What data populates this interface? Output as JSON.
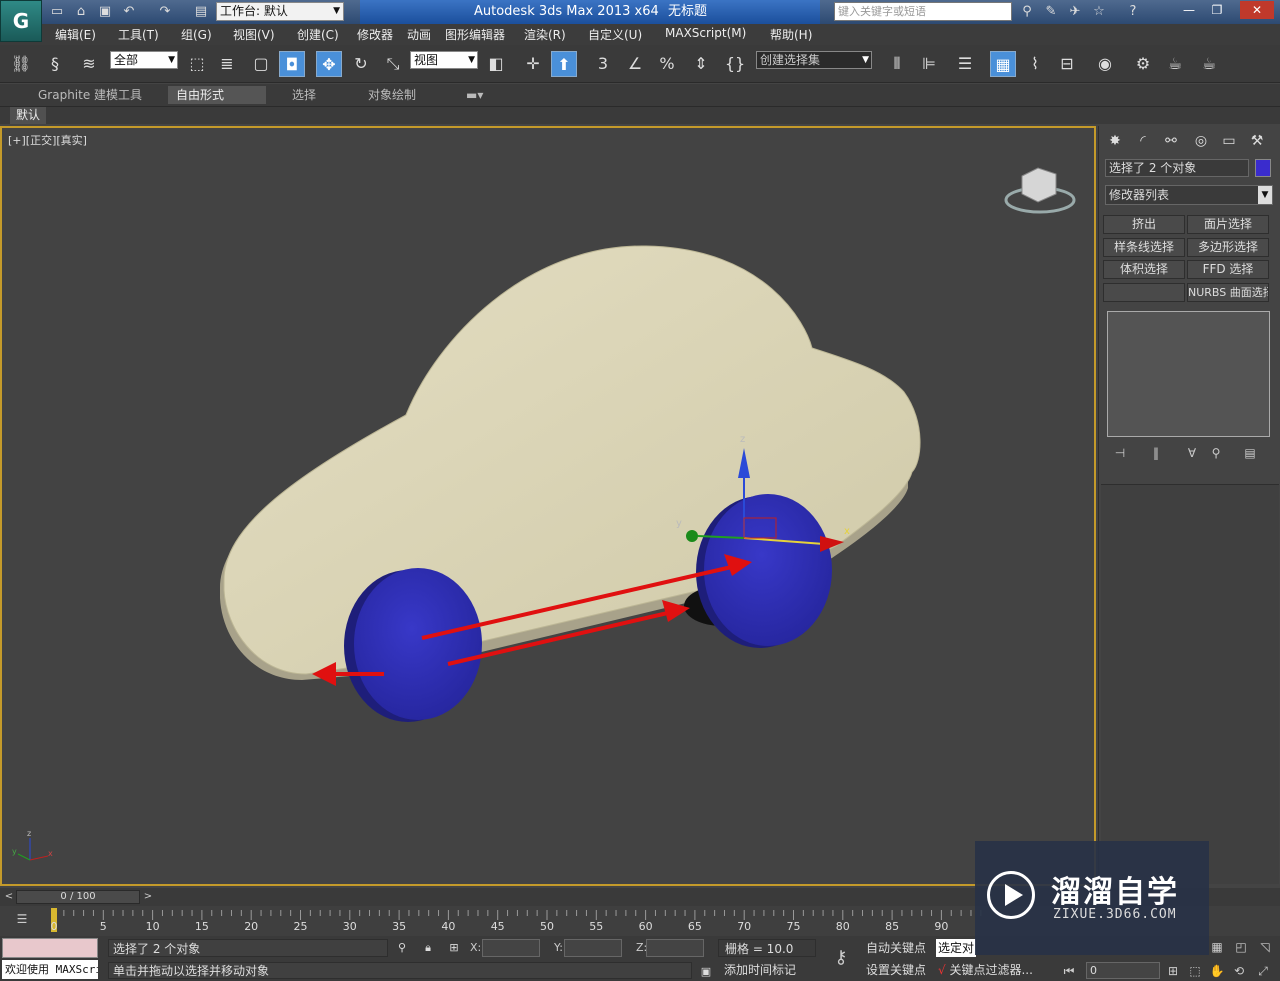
{
  "titlebar": {
    "workspace_label": "工作台: 默认",
    "app_title": "Autodesk 3ds Max  2013 x64",
    "document_title": "无标题",
    "search_placeholder": "键入关键字或短语"
  },
  "menu": [
    "编辑(E)",
    "工具(T)",
    "组(G)",
    "视图(V)",
    "创建(C)",
    "修改器",
    "动画",
    "图形编辑器",
    "渲染(R)",
    "自定义(U)",
    "MAXScript(M)",
    "帮助(H)"
  ],
  "toolbar": {
    "selection_filter": "全部",
    "ref_coord": "视图",
    "named_selection": "创建选择集",
    "snap_label": "3",
    "percent_label": "%"
  },
  "ribbon": {
    "tabs": [
      "Graphite 建模工具",
      "自由形式",
      "选择",
      "对象绘制"
    ],
    "active_tab": "自由形式",
    "sub_tab": "默认"
  },
  "viewport": {
    "label": "[+][正交][真实]",
    "gizmo_axes": {
      "x": "x",
      "y": "y",
      "z": "z"
    }
  },
  "command_panel": {
    "selection_text": "选择了 2 个对象",
    "selection_color": "#3a2ccd",
    "modifier_list": "修改器列表",
    "buttons": [
      {
        "label": "挤出"
      },
      {
        "label": "面片选择"
      },
      {
        "label": "样条线选择"
      },
      {
        "label": "多边形选择"
      },
      {
        "label": "体积选择"
      },
      {
        "label": "FFD 选择"
      },
      {
        "label": ""
      },
      {
        "label": "NURBS 曲面选择"
      }
    ]
  },
  "timeline": {
    "frame_text": "0 / 100",
    "ticks": [
      "0",
      "5",
      "10",
      "15",
      "20",
      "25",
      "30",
      "35",
      "40",
      "45",
      "50",
      "55",
      "60",
      "65",
      "70",
      "75",
      "80",
      "85",
      "90"
    ]
  },
  "status": {
    "welcome": "欢迎使用 MAXScri",
    "selection": "选择了 2 个对象",
    "prompt": "单击并拖动以选择并移动对象",
    "x_label": "X:",
    "y_label": "Y:",
    "z_label": "Z:",
    "grid": "栅格 = 10.0",
    "add_time_tag": "添加时间标记",
    "auto_key": "自动关键点",
    "set_key": "设置关键点",
    "key_select": "选定对",
    "key_filter": "关键点过滤器...",
    "frame": "0"
  },
  "watermark": {
    "title": "溜溜自学",
    "url": "ZIXUE.3D66.COM"
  },
  "colors": {
    "car_body": "#d9d3b5",
    "wheel": "#2f2fb8",
    "arrow": "#e01010",
    "viewport_border": "#c49a2a"
  }
}
